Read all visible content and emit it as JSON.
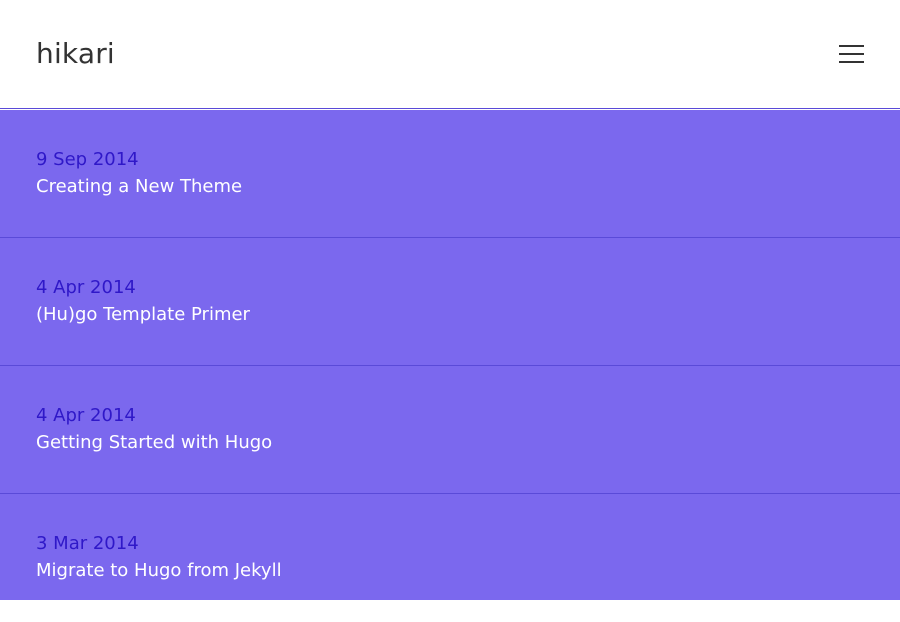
{
  "site": {
    "brand": "hikari"
  },
  "header": {
    "menu_icon": "hamburger-menu-icon"
  },
  "colors": {
    "header_bg": "#ffffff",
    "list_bg": "#7b68ee",
    "date_text": "#2f18c8",
    "title_text": "#ffffff",
    "divider": "#5a4ad8"
  },
  "posts": [
    {
      "date": "9 Sep 2014",
      "title": "Creating a New Theme"
    },
    {
      "date": "4 Apr 2014",
      "title": "(Hu)go Template Primer"
    },
    {
      "date": "4 Apr 2014",
      "title": "Getting Started with Hugo"
    },
    {
      "date": "3 Mar 2014",
      "title": "Migrate to Hugo from Jekyll"
    }
  ]
}
